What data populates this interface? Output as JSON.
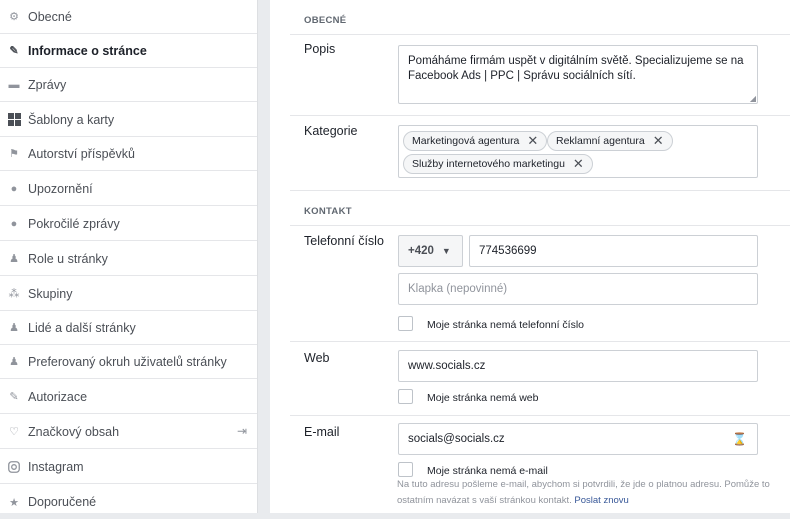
{
  "sidebar": {
    "items": [
      {
        "label": "Obecné",
        "icon": "gear-icon"
      },
      {
        "label": "Informace o stránce",
        "icon": "pencil-icon",
        "active": true
      },
      {
        "label": "Zprávy",
        "icon": "chat-icon"
      },
      {
        "label": "Šablony a karty",
        "icon": "grid-icon"
      },
      {
        "label": "Autorství příspěvků",
        "icon": "flag-icon"
      },
      {
        "label": "Upozornění",
        "icon": "globe-icon"
      },
      {
        "label": "Pokročilé zprávy",
        "icon": "messenger-icon"
      },
      {
        "label": "Role u stránky",
        "icon": "person-icon"
      },
      {
        "label": "Skupiny",
        "icon": "group-icon"
      },
      {
        "label": "Lidé a další stránky",
        "icon": "person-add-icon"
      },
      {
        "label": "Preferovaný okruh uživatelů stránky",
        "icon": "person-add-icon"
      },
      {
        "label": "Autorizace",
        "icon": "wrench-icon"
      },
      {
        "label": "Značkový obsah",
        "icon": "handshake-icon"
      },
      {
        "label": "Instagram",
        "icon": "instagram-icon"
      },
      {
        "label": "Doporučené",
        "icon": "star-icon"
      }
    ]
  },
  "general": {
    "heading": "OBECNÉ",
    "description_label": "Popis",
    "description_value": "Pomáháme firmám uspět v digitálním světě. Specializujeme se na Facebook Ads | PPC | Správu sociálních sítí.",
    "category_label": "Kategorie",
    "categories": [
      "Marketingová agentura",
      "Reklamní agentura",
      "Služby internetového marketingu"
    ]
  },
  "contact": {
    "heading": "KONTAKT",
    "phone_label": "Telefonní číslo",
    "country_code": "+420",
    "phone_value": "774536699",
    "extension_placeholder": "Klapka (nepovinné)",
    "no_phone_label": "Moje stránka nemá telefonní číslo",
    "web_label": "Web",
    "web_value": "www.socials.cz",
    "no_web_label": "Moje stránka nemá web",
    "email_label": "E-mail",
    "email_value": "socials@socials.cz",
    "no_email_label": "Moje stránka nemá e-mail",
    "email_hint": "Na tuto adresu pošleme e-mail, abychom si potvrdili, že jde o platnou adresu. Pomůže to ostatním navázat s vaší stránkou kontakt.",
    "resend_link": "Poslat znovu"
  }
}
